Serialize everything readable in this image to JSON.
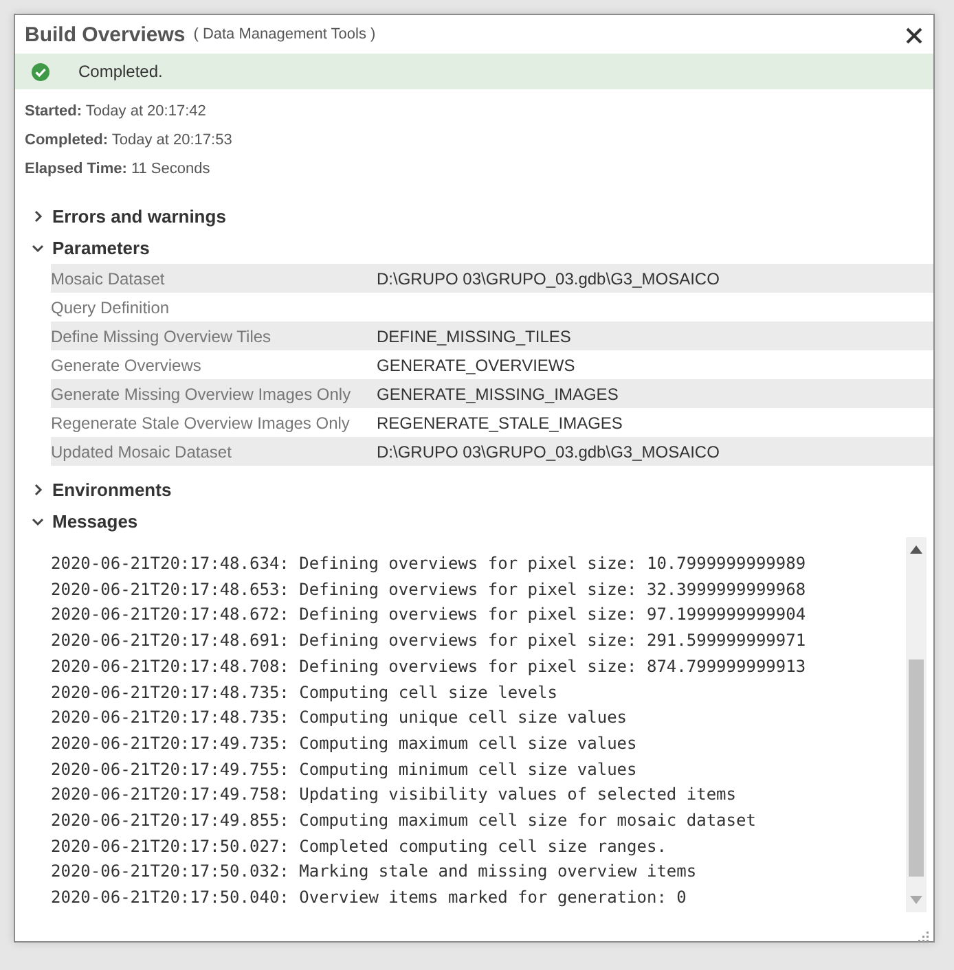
{
  "window": {
    "title": "Build Overviews",
    "subtitle": "( Data Management Tools )"
  },
  "status": {
    "kind": "success",
    "text": "Completed."
  },
  "summary": [
    {
      "label": "Started:",
      "value": "Today at 20:17:42"
    },
    {
      "label": "Completed:",
      "value": "Today at 20:17:53"
    },
    {
      "label": "Elapsed Time:",
      "value": "11 Seconds"
    }
  ],
  "sections": [
    {
      "kind": "plain",
      "title": "Errors and warnings",
      "expanded": false
    },
    {
      "kind": "parameters",
      "title": "Parameters",
      "expanded": true,
      "rows": [
        {
          "name": "Mosaic Dataset",
          "value": "D:\\GRUPO 03\\GRUPO_03.gdb\\G3_MOSAICO"
        },
        {
          "name": "Query Definition",
          "value": ""
        },
        {
          "name": "Define Missing Overview Tiles",
          "value": "DEFINE_MISSING_TILES"
        },
        {
          "name": "Generate Overviews",
          "value": "GENERATE_OVERVIEWS"
        },
        {
          "name": "Generate Missing Overview Images Only",
          "value": "GENERATE_MISSING_IMAGES"
        },
        {
          "name": "Regenerate Stale Overview Images Only",
          "value": "REGENERATE_STALE_IMAGES"
        },
        {
          "name": "Updated Mosaic Dataset",
          "value": "D:\\GRUPO 03\\GRUPO_03.gdb\\G3_MOSAICO"
        }
      ]
    },
    {
      "kind": "plain",
      "title": "Environments",
      "expanded": false
    },
    {
      "kind": "messages",
      "title": "Messages",
      "expanded": true,
      "lines": [
        "2020-06-21T20:17:48.634: Defining overviews for pixel size: 10.7999999999989",
        "2020-06-21T20:17:48.653: Defining overviews for pixel size: 32.3999999999968",
        "2020-06-21T20:17:48.672: Defining overviews for pixel size: 97.1999999999904",
        "2020-06-21T20:17:48.691: Defining overviews for pixel size: 291.599999999971",
        "2020-06-21T20:17:48.708: Defining overviews for pixel size: 874.799999999913",
        "2020-06-21T20:17:48.735: Computing cell size levels",
        "2020-06-21T20:17:48.735: Computing unique cell size values",
        "2020-06-21T20:17:49.735: Computing maximum cell size values",
        "2020-06-21T20:17:49.755: Computing minimum cell size values",
        "2020-06-21T20:17:49.758: Updating visibility values of selected items",
        "2020-06-21T20:17:49.855: Computing maximum cell size for mosaic dataset",
        "2020-06-21T20:17:50.027: Completed computing cell size ranges.",
        "2020-06-21T20:17:50.032: Marking stale and missing overview items",
        "2020-06-21T20:17:50.040: Overview items marked for generation: 0"
      ]
    }
  ]
}
